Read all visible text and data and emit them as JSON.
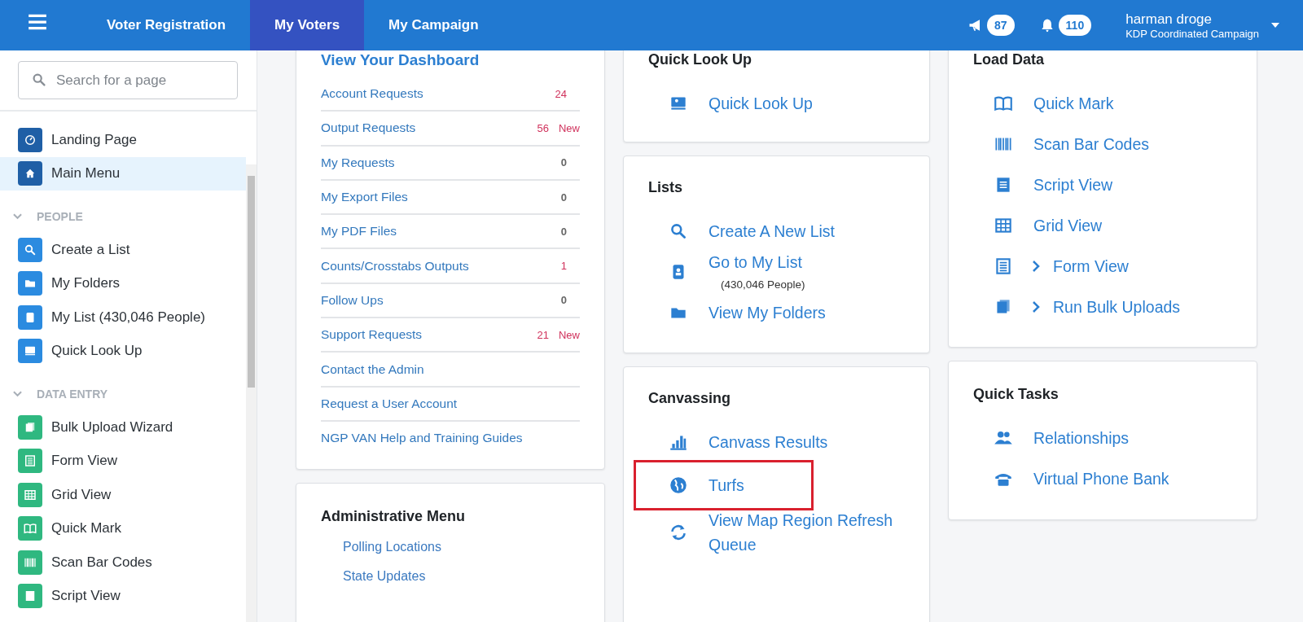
{
  "top_nav": {
    "tabs": [
      {
        "label": "Voter Registration",
        "selected": false
      },
      {
        "label": "My Voters",
        "selected": true
      },
      {
        "label": "My Campaign",
        "selected": false
      }
    ],
    "announcements_count": "87",
    "notifications_count": "110",
    "user_name": "harman droge",
    "user_org": "KDP Coordinated Campaign"
  },
  "sidebar": {
    "search": {
      "placeholder": "Search for a page"
    },
    "sections": [
      {
        "color": "#1f5fa6",
        "items": [
          {
            "label": "Landing Page",
            "selected": false
          },
          {
            "label": "Main Menu",
            "selected": true
          }
        ]
      },
      {
        "heading": "PEOPLE",
        "color": "#2b8be0",
        "items": [
          {
            "label": "Create a List",
            "selected": false
          },
          {
            "label": "My Folders",
            "selected": false
          },
          {
            "label": "My List (430,046 People)",
            "selected": false
          },
          {
            "label": "Quick Look Up",
            "selected": false
          }
        ]
      },
      {
        "heading": "DATA ENTRY",
        "color": "#2fb880",
        "items": [
          {
            "label": "Bulk Upload Wizard",
            "selected": false
          },
          {
            "label": "Form View",
            "selected": false
          },
          {
            "label": "Grid View",
            "selected": false
          },
          {
            "label": "Quick Mark",
            "selected": false
          },
          {
            "label": "Scan Bar Codes",
            "selected": false
          },
          {
            "label": "Script View",
            "selected": false
          }
        ]
      }
    ]
  },
  "dashboard": {
    "title": "View Your Dashboard",
    "rows": [
      {
        "label": "Account Requests",
        "count": "24",
        "alert": true
      },
      {
        "label": "Output Requests",
        "count": "56",
        "alert": true,
        "badge": "New"
      },
      {
        "label": "My Requests",
        "count": "0",
        "alert": false
      },
      {
        "label": "My Export Files",
        "count": "0",
        "alert": false
      },
      {
        "label": "My PDF Files",
        "count": "0",
        "alert": false
      },
      {
        "label": "Counts/Crosstabs Outputs",
        "count": "1",
        "alert": true
      },
      {
        "label": "Follow Ups",
        "count": "0",
        "alert": false
      },
      {
        "label": "Support Requests",
        "count": "21",
        "alert": true,
        "badge": "New"
      },
      {
        "label": "Contact the Admin"
      },
      {
        "label": "Request a User Account"
      },
      {
        "label": "NGP VAN Help and Training Guides"
      }
    ]
  },
  "administrative_menu": {
    "title": "Administrative Menu",
    "links": [
      "Polling Locations",
      "State Updates"
    ]
  },
  "quick_look_up": {
    "title": "Quick Look Up",
    "links": [
      {
        "label": "Quick Look Up"
      }
    ]
  },
  "lists": {
    "title": "Lists",
    "links": [
      {
        "label": "Create A New List"
      },
      {
        "label": "Go to My List",
        "sub": "(430,046 People)"
      },
      {
        "label": "View My Folders"
      }
    ]
  },
  "canvassing": {
    "title": "Canvassing",
    "links": [
      {
        "label": "Canvass Results",
        "highlighted": false
      },
      {
        "label": "Turfs",
        "highlighted": true
      },
      {
        "label": "View Map Region Refresh Queue",
        "highlighted": false
      }
    ]
  },
  "load_data": {
    "title": "Load Data",
    "links": [
      {
        "label": "Quick Mark",
        "expandable": false
      },
      {
        "label": "Scan Bar Codes",
        "expandable": false
      },
      {
        "label": "Script View",
        "expandable": false
      },
      {
        "label": "Grid View",
        "expandable": false
      },
      {
        "label": "Form View",
        "expandable": true
      },
      {
        "label": "Run Bulk Uploads",
        "expandable": true
      }
    ]
  },
  "quick_tasks": {
    "title": "Quick Tasks",
    "links": [
      {
        "label": "Relationships"
      },
      {
        "label": "Virtual Phone Bank"
      }
    ]
  }
}
